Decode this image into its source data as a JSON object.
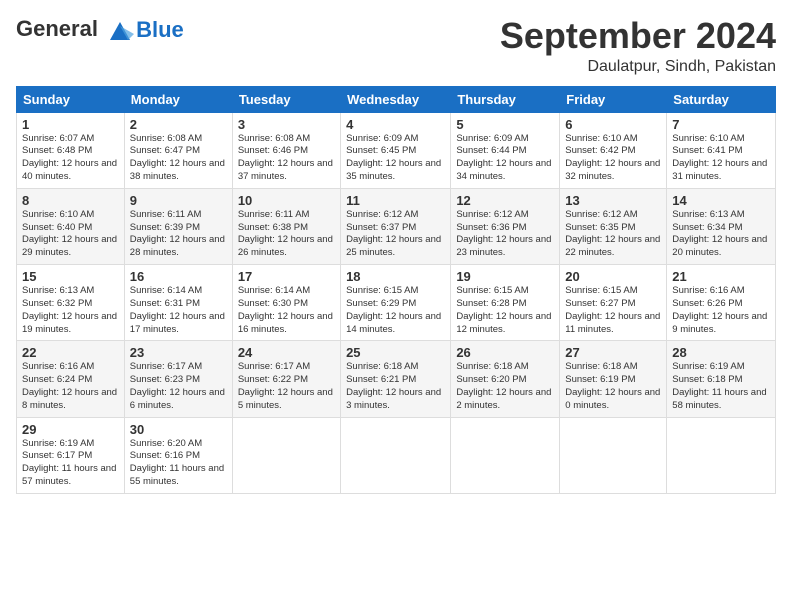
{
  "header": {
    "logo_line1": "General",
    "logo_line2": "Blue",
    "month": "September 2024",
    "location": "Daulatpur, Sindh, Pakistan"
  },
  "weekdays": [
    "Sunday",
    "Monday",
    "Tuesday",
    "Wednesday",
    "Thursday",
    "Friday",
    "Saturday"
  ],
  "weeks": [
    [
      {
        "day": "1",
        "rise": "Sunrise: 6:07 AM",
        "set": "Sunset: 6:48 PM",
        "daylight": "Daylight: 12 hours and 40 minutes."
      },
      {
        "day": "2",
        "rise": "Sunrise: 6:08 AM",
        "set": "Sunset: 6:47 PM",
        "daylight": "Daylight: 12 hours and 38 minutes."
      },
      {
        "day": "3",
        "rise": "Sunrise: 6:08 AM",
        "set": "Sunset: 6:46 PM",
        "daylight": "Daylight: 12 hours and 37 minutes."
      },
      {
        "day": "4",
        "rise": "Sunrise: 6:09 AM",
        "set": "Sunset: 6:45 PM",
        "daylight": "Daylight: 12 hours and 35 minutes."
      },
      {
        "day": "5",
        "rise": "Sunrise: 6:09 AM",
        "set": "Sunset: 6:44 PM",
        "daylight": "Daylight: 12 hours and 34 minutes."
      },
      {
        "day": "6",
        "rise": "Sunrise: 6:10 AM",
        "set": "Sunset: 6:42 PM",
        "daylight": "Daylight: 12 hours and 32 minutes."
      },
      {
        "day": "7",
        "rise": "Sunrise: 6:10 AM",
        "set": "Sunset: 6:41 PM",
        "daylight": "Daylight: 12 hours and 31 minutes."
      }
    ],
    [
      {
        "day": "8",
        "rise": "Sunrise: 6:10 AM",
        "set": "Sunset: 6:40 PM",
        "daylight": "Daylight: 12 hours and 29 minutes."
      },
      {
        "day": "9",
        "rise": "Sunrise: 6:11 AM",
        "set": "Sunset: 6:39 PM",
        "daylight": "Daylight: 12 hours and 28 minutes."
      },
      {
        "day": "10",
        "rise": "Sunrise: 6:11 AM",
        "set": "Sunset: 6:38 PM",
        "daylight": "Daylight: 12 hours and 26 minutes."
      },
      {
        "day": "11",
        "rise": "Sunrise: 6:12 AM",
        "set": "Sunset: 6:37 PM",
        "daylight": "Daylight: 12 hours and 25 minutes."
      },
      {
        "day": "12",
        "rise": "Sunrise: 6:12 AM",
        "set": "Sunset: 6:36 PM",
        "daylight": "Daylight: 12 hours and 23 minutes."
      },
      {
        "day": "13",
        "rise": "Sunrise: 6:12 AM",
        "set": "Sunset: 6:35 PM",
        "daylight": "Daylight: 12 hours and 22 minutes."
      },
      {
        "day": "14",
        "rise": "Sunrise: 6:13 AM",
        "set": "Sunset: 6:34 PM",
        "daylight": "Daylight: 12 hours and 20 minutes."
      }
    ],
    [
      {
        "day": "15",
        "rise": "Sunrise: 6:13 AM",
        "set": "Sunset: 6:32 PM",
        "daylight": "Daylight: 12 hours and 19 minutes."
      },
      {
        "day": "16",
        "rise": "Sunrise: 6:14 AM",
        "set": "Sunset: 6:31 PM",
        "daylight": "Daylight: 12 hours and 17 minutes."
      },
      {
        "day": "17",
        "rise": "Sunrise: 6:14 AM",
        "set": "Sunset: 6:30 PM",
        "daylight": "Daylight: 12 hours and 16 minutes."
      },
      {
        "day": "18",
        "rise": "Sunrise: 6:15 AM",
        "set": "Sunset: 6:29 PM",
        "daylight": "Daylight: 12 hours and 14 minutes."
      },
      {
        "day": "19",
        "rise": "Sunrise: 6:15 AM",
        "set": "Sunset: 6:28 PM",
        "daylight": "Daylight: 12 hours and 12 minutes."
      },
      {
        "day": "20",
        "rise": "Sunrise: 6:15 AM",
        "set": "Sunset: 6:27 PM",
        "daylight": "Daylight: 12 hours and 11 minutes."
      },
      {
        "day": "21",
        "rise": "Sunrise: 6:16 AM",
        "set": "Sunset: 6:26 PM",
        "daylight": "Daylight: 12 hours and 9 minutes."
      }
    ],
    [
      {
        "day": "22",
        "rise": "Sunrise: 6:16 AM",
        "set": "Sunset: 6:24 PM",
        "daylight": "Daylight: 12 hours and 8 minutes."
      },
      {
        "day": "23",
        "rise": "Sunrise: 6:17 AM",
        "set": "Sunset: 6:23 PM",
        "daylight": "Daylight: 12 hours and 6 minutes."
      },
      {
        "day": "24",
        "rise": "Sunrise: 6:17 AM",
        "set": "Sunset: 6:22 PM",
        "daylight": "Daylight: 12 hours and 5 minutes."
      },
      {
        "day": "25",
        "rise": "Sunrise: 6:18 AM",
        "set": "Sunset: 6:21 PM",
        "daylight": "Daylight: 12 hours and 3 minutes."
      },
      {
        "day": "26",
        "rise": "Sunrise: 6:18 AM",
        "set": "Sunset: 6:20 PM",
        "daylight": "Daylight: 12 hours and 2 minutes."
      },
      {
        "day": "27",
        "rise": "Sunrise: 6:18 AM",
        "set": "Sunset: 6:19 PM",
        "daylight": "Daylight: 12 hours and 0 minutes."
      },
      {
        "day": "28",
        "rise": "Sunrise: 6:19 AM",
        "set": "Sunset: 6:18 PM",
        "daylight": "Daylight: 11 hours and 58 minutes."
      }
    ],
    [
      {
        "day": "29",
        "rise": "Sunrise: 6:19 AM",
        "set": "Sunset: 6:17 PM",
        "daylight": "Daylight: 11 hours and 57 minutes."
      },
      {
        "day": "30",
        "rise": "Sunrise: 6:20 AM",
        "set": "Sunset: 6:16 PM",
        "daylight": "Daylight: 11 hours and 55 minutes."
      },
      null,
      null,
      null,
      null,
      null
    ]
  ]
}
